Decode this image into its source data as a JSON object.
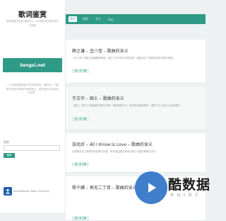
{
  "sidebar": {
    "site_title": "歌词鉴赏",
    "site_desc": "解析歌曲背后的深情含义，探寻歌词的深层意境与情感",
    "logo_text": "Sengsi.net",
    "intro": "一个探索歌曲情感与意境的网站，带你深入了解歌词背后的故事与情感表达，品味音乐中的诗意与哲思。",
    "search_label": "搜索",
    "search_button": "搜索",
    "app_label": "SpeedReader Book Summary"
  },
  "nav": {
    "items": [
      "首页",
      "搜索",
      "关于",
      "App"
    ]
  },
  "posts": [
    {
      "title": "薛之谦 – 丑八怪 – 歌曲的含义",
      "body": "《丑八怪》是薛之谦演唱的歌曲，表达了对外在评判的反思，歌曲传达了接受自我的态度与情感。",
      "more": "进一步了解"
    },
    {
      "title": "于文华 – 国土 – 歌曲的含义",
      "body": "《国土》表达了对祖国的热爱与深情。歌曲旋律大气，歌词饱含家国情怀，展现了对土地与人民的眷恋。",
      "more": "进一步了解"
    },
    {
      "title": "张润贞 – All I Know Is Love – 歌曲的含义",
      "body": "这首歌讲述了爱情中的真挚与执着，歌手用温柔的声音诠释了对爱的理解与坚守。",
      "more": "进一步了解"
    },
    {
      "title": "杨千嬅 – 再见二丁目 – 歌曲的含义",
      "body": "",
      "more": "进一步了解"
    }
  ],
  "watermark": {
    "text": "酷数据",
    "sub": "KUIDC"
  },
  "colors": {
    "accent": "#2f9a86",
    "watermark_blue": "#3e7ecb",
    "app_icon": "#1f5fa8"
  }
}
